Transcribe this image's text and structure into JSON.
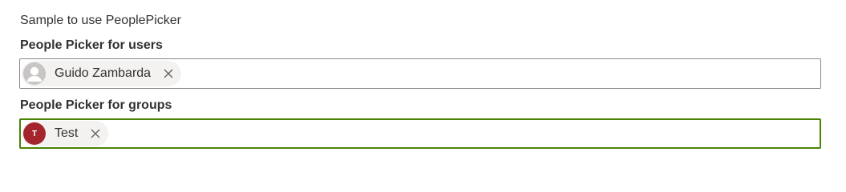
{
  "intro_text": "Sample to use PeoplePicker",
  "users_picker": {
    "label": "People Picker for users",
    "selected": [
      {
        "name": "Guido Zambarda",
        "avatar": "person-silhouette-icon"
      }
    ]
  },
  "groups_picker": {
    "label": "People Picker for groups",
    "selected": [
      {
        "name": "Test",
        "initials": "T",
        "avatar_color": "#a4262c"
      }
    ]
  },
  "colors": {
    "focus_border": "#498205",
    "default_border": "#8a8886",
    "pill_background": "#f3f2f1"
  }
}
